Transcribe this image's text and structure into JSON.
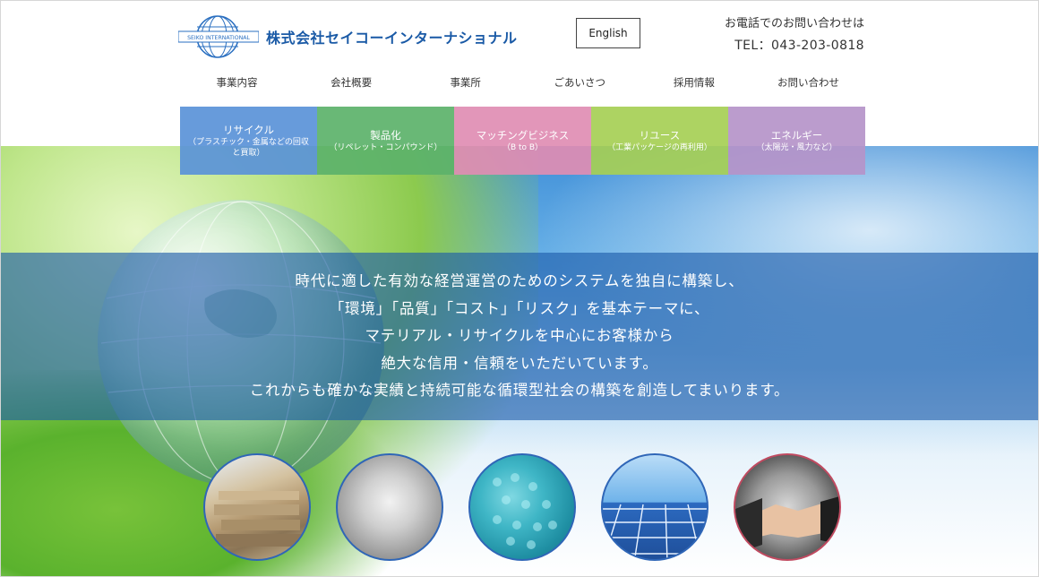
{
  "header": {
    "company_name": "株式会社セイコーインターナショナル",
    "logo_text": "SEIKO INTERNATIONAL",
    "english_button": "English",
    "contact_lead": "お電話でのお問い合わせは",
    "contact_tel": "TEL：043-203-0818"
  },
  "nav": {
    "items": [
      "事業内容",
      "会社概要",
      "事業所",
      "ごあいさつ",
      "採用情報",
      "お問い合わせ"
    ]
  },
  "categories": [
    {
      "title": "リサイクル",
      "sub": "（プラスチック・金属などの回収と買取）",
      "color": "#5a93d8"
    },
    {
      "title": "製品化",
      "sub": "（リペレット・コンパウンド）",
      "color": "#5cb26a"
    },
    {
      "title": "マッチングビジネス",
      "sub": "（B to B）",
      "color": "#e08db3"
    },
    {
      "title": "リユース",
      "sub": "（工業パッケージの再利用）",
      "color": "#a6cf55"
    },
    {
      "title": "エネルギー",
      "sub": "（太陽光・風力など）",
      "color": "#b594c9"
    }
  ],
  "message": {
    "lines": [
      "時代に適した有効な経営運営のためのシステムを独自に構築し、",
      "「環境」「品質」「コスト」「リスク」を基本テーマに、",
      "マテリアル・リサイクルを中心にお客様から",
      "絶大な信用・信頼をいただいています。",
      "これからも確かな実績と持続可能な循環型社会の構築を創造してまいります。"
    ]
  },
  "circles": [
    {
      "icon": "scrap-material-icon"
    },
    {
      "icon": "white-powder-icon"
    },
    {
      "icon": "blue-pellets-icon"
    },
    {
      "icon": "solar-panel-icon"
    },
    {
      "icon": "handshake-icon"
    }
  ]
}
